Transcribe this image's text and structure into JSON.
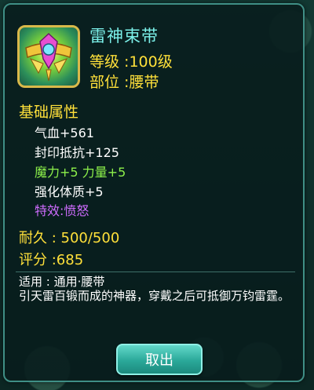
{
  "item": {
    "name": "雷神束带",
    "level_line": "等级 :100级",
    "slot_line": "部位 :腰带",
    "icon": "belt-item-icon"
  },
  "base_attributes": {
    "heading": "基础属性",
    "lines": [
      "气血+561",
      "封印抵抗+125",
      "魔力+5 力量+5",
      "强化体质+5",
      "特效:愤怒"
    ]
  },
  "stats": {
    "durability": "耐久 :  500/500",
    "score": "评分 :685"
  },
  "description": {
    "usage": "适用 : 通用·腰带",
    "flavor": "引天雷百锻而成的神器，穿戴之后可抵御万钧雷霆。"
  },
  "actions": {
    "remove_label": "取出"
  },
  "colors": {
    "title": "#7cf1ea",
    "gold": "#ffe03a",
    "green": "#8cf04a",
    "purple": "#cf6cff",
    "border": "#3f8f86"
  }
}
